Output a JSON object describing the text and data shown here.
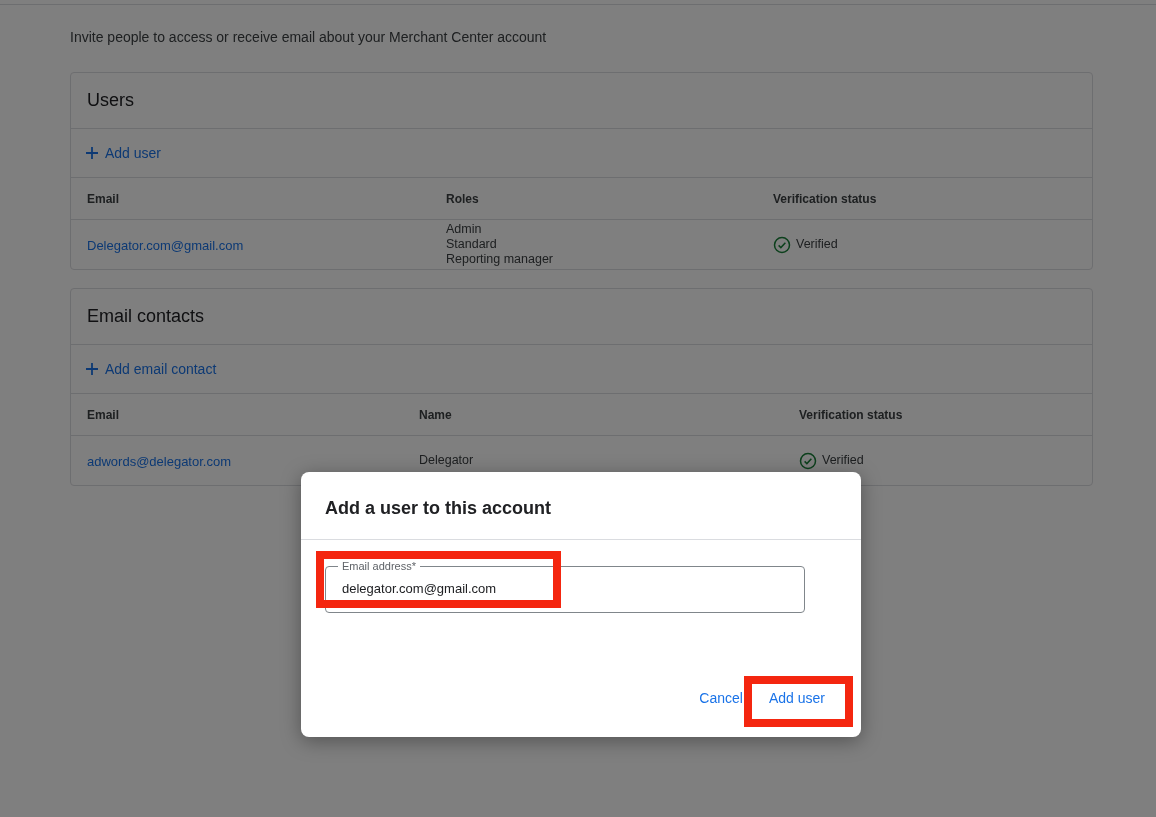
{
  "subtitle": "Invite people to access or receive email about your Merchant Center account",
  "users": {
    "title": "Users",
    "add_action": "Add user",
    "columns": [
      "Email",
      "Roles",
      "Verification status"
    ],
    "rows": [
      {
        "email": "Delegator.com@gmail.com",
        "roles": [
          "Admin",
          "Standard",
          "Reporting manager"
        ],
        "status": "Verified",
        "verified": true
      }
    ]
  },
  "email_contacts": {
    "title": "Email contacts",
    "add_action": "Add email contact",
    "columns": [
      "Email",
      "Name",
      "Verification status"
    ],
    "rows": [
      {
        "email": "adwords@delegator.com",
        "name": "Delegator",
        "status": "Verified",
        "verified": true
      }
    ]
  },
  "dialog": {
    "title": "Add a user to this account",
    "field": {
      "label": "Email address*",
      "value": "delegator.com@gmail.com",
      "highlighted": true
    },
    "buttons": [
      {
        "label": "Cancel",
        "highlighted": false
      },
      {
        "label": "Add user",
        "highlighted": true
      }
    ]
  }
}
